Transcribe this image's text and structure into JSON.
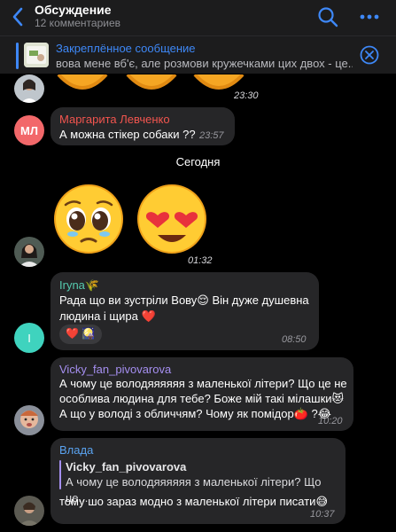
{
  "header": {
    "title": "Обсуждение",
    "subtitle": "12 комментариев"
  },
  "pinned": {
    "title": "Закреплённое сообщение",
    "text": "вова мене вб'є, але розмови кружечками цих двох - це..."
  },
  "messages": {
    "sticker_top": {
      "time": "23:30"
    },
    "margarita": {
      "name": "Маргарита Левченко",
      "name_color": "#f2554f",
      "avatar_initials": "МЛ",
      "avatar_color": "#f2686a",
      "text": "А можна стікер собаки ??",
      "time": "23:57"
    },
    "date_separator": "Сегодня",
    "stickers_today": {
      "time": "01:32"
    },
    "iryna": {
      "name": "Iryna🌾",
      "name_color": "#56cbb0",
      "avatar_initial": "I",
      "avatar_color": "#3fd3be",
      "line1": "Рада що ви зустріли Вову😌 Він дуже душевна",
      "line2": "людина і щира ❤️",
      "reactions": "❤️ 🎑",
      "time": "08:50"
    },
    "vicky": {
      "name": "Vicky_fan_pivovarova",
      "name_color": "#a58ff0",
      "line1": "А чому це володяяяяяя з маленької літери? Що це не",
      "line2": "особлива людина для тебе? Боже мій такі мілашки😻",
      "line3": "А що у володі з обличчям? Чому як помідор🍅 ?😂",
      "time": "10:20"
    },
    "vlada": {
      "name": "Влада",
      "name_color": "#5aa3f0",
      "reply_name": "Vicky_fan_pivovarova",
      "reply_text": "А чому це володяяяяяя з маленької літери? Що це...",
      "text": "тому шо зараз модно з маленької літери писати😅",
      "time": "10:37"
    }
  },
  "colors": {
    "accent": "#3e88f7",
    "bubble": "#262628",
    "header_bg": "#1c1c1d"
  }
}
